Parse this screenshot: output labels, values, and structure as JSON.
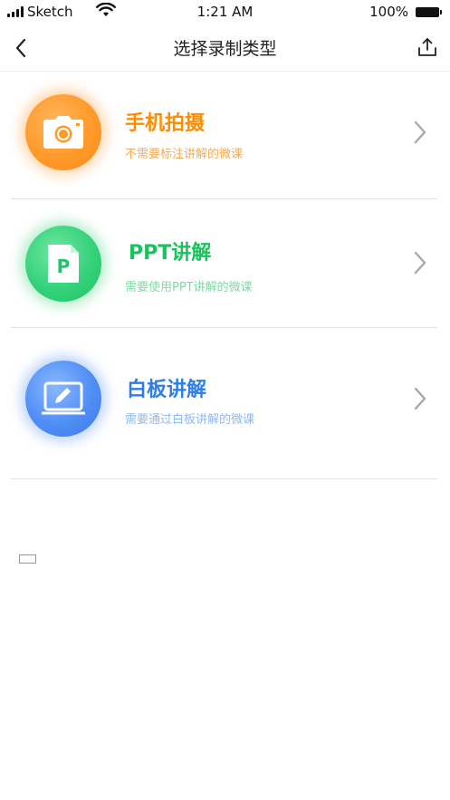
{
  "status_bar": {
    "carrier": "Sketch",
    "time": "1:21 AM",
    "battery": "100%"
  },
  "nav": {
    "title": "选择录制类型",
    "back_icon": "chevron-left-icon",
    "share_icon": "share-upload-icon"
  },
  "options": [
    {
      "title": "手机拍摄",
      "description": "不需要标注讲解的微课",
      "icon": "camera-icon",
      "title_color": "#ff8c00",
      "desc_color": "#f7a94e"
    },
    {
      "title": "PPT讲解",
      "description": "需要使用PPT讲解的微课",
      "icon": "ppt-file-icon",
      "title_color": "#17c35a",
      "desc_color": "#7fd9a4"
    },
    {
      "title": "白板讲解",
      "description": "需要通过白板讲解的微课",
      "icon": "whiteboard-icon",
      "title_color": "#2f7de8",
      "desc_color": "#8db8f2"
    }
  ],
  "colors": {
    "chevron": "#a8a8a8",
    "divider": "#e3e3e3"
  }
}
